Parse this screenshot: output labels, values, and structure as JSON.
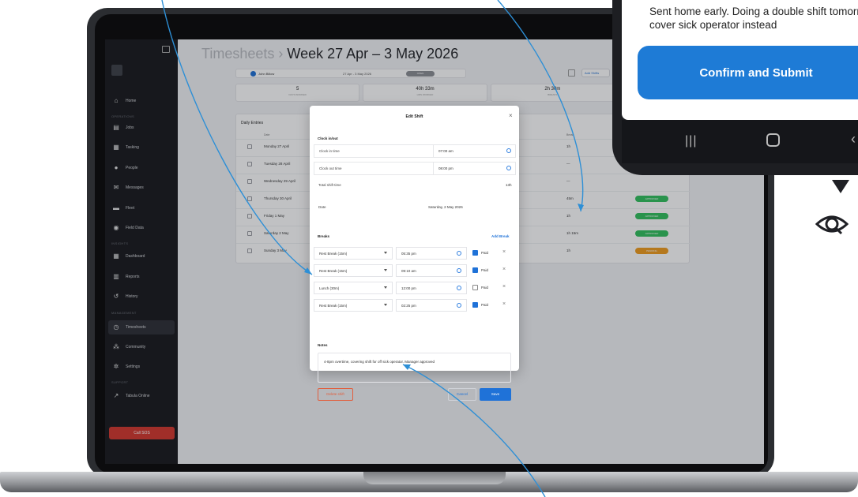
{
  "sidebar": {
    "sections": [
      "OPERATIONS",
      "INSIGHTS",
      "MANAGEMENT",
      "SUPPORT"
    ],
    "items": [
      {
        "label": "Home",
        "icon": "home-icon"
      },
      {
        "label": "Jobs",
        "icon": "jobs-icon"
      },
      {
        "label": "Tasking",
        "icon": "tasking-icon"
      },
      {
        "label": "People",
        "icon": "people-icon"
      },
      {
        "label": "Messages",
        "icon": "messages-icon"
      },
      {
        "label": "Fleet",
        "icon": "fleet-icon"
      },
      {
        "label": "Field Data",
        "icon": "field-data-icon"
      },
      {
        "label": "Dashboard",
        "icon": "dashboard-icon"
      },
      {
        "label": "Reports",
        "icon": "reports-icon"
      },
      {
        "label": "History",
        "icon": "history-icon"
      },
      {
        "label": "Timesheets",
        "icon": "clock-icon"
      },
      {
        "label": "Community",
        "icon": "community-icon"
      },
      {
        "label": "Settings",
        "icon": "gear-icon"
      },
      {
        "label": "Tabula Online",
        "icon": "external-link-icon"
      }
    ],
    "sos_label": "Call SOS"
  },
  "header": {
    "crumb": "Timesheets",
    "separator": "›",
    "title": "Week 27 Apr – 3 May 2026"
  },
  "toolbar": {
    "employee": "John Billow",
    "week_range": "27 Apr - 3 May 2026",
    "status": "OPEN",
    "add_label": "Add Shifts"
  },
  "stats": [
    {
      "value": "5",
      "label": "DAYS WORKED"
    },
    {
      "value": "40h 33m",
      "label": "HRS WORKED"
    },
    {
      "value": "2h 30m",
      "label": "BREAKS"
    }
  ],
  "entries": {
    "title": "Daily Entries",
    "col_date": "Date",
    "col_break": "Break",
    "rows": [
      {
        "date": "Monday 27 April",
        "break": "1h",
        "status": ""
      },
      {
        "date": "Tuesday 28 April",
        "break": "—",
        "status": ""
      },
      {
        "date": "Wednesday 29 April",
        "break": "—",
        "status": ""
      },
      {
        "date": "Thursday 30 April",
        "break": "45m",
        "status": "APPROVED"
      },
      {
        "date": "Friday 1 May",
        "break": "1h",
        "status": "APPROVED"
      },
      {
        "date": "Saturday 2 May",
        "break": "1h 15m",
        "status": "APPROVED"
      },
      {
        "date": "Sunday 3 May",
        "break": "1h",
        "status": "PENDING"
      }
    ]
  },
  "modal": {
    "title": "Edit Shift",
    "clock_section": "Clock in/out",
    "clock_in_label": "Clock in time",
    "clock_in_value": "07:00 am",
    "clock_out_label": "Clock out time",
    "clock_out_value": "08:00 pm",
    "total_label": "Total shift time",
    "total_value": "13h",
    "date_label": "Date",
    "date_value": "Saturday, 2 May 2026",
    "breaks_section": "Breaks",
    "add_break": "Add Break",
    "paid_label": "Paid",
    "breaks": [
      {
        "type": "Rest Break (15m)",
        "time": "05:35 pm",
        "paid": true
      },
      {
        "type": "Rest Break (15m)",
        "time": "09:10 am",
        "paid": true
      },
      {
        "type": "Lunch (30m)",
        "time": "12:00 pm",
        "paid": false
      },
      {
        "type": "Rest Break (15m)",
        "time": "02:25 pm",
        "paid": true
      }
    ],
    "notes_label": "Notes",
    "notes_value": "4-8pm overtime, covering shift for off sick operator. Manager approved",
    "delete_label": "Delete shift",
    "cancel_label": "Cancel",
    "save_label": "Save"
  },
  "phone": {
    "note_text": "Sent home early. Doing a double shift tomorrow to cover sick operator instead",
    "confirm_label": "Confirm and Submit"
  },
  "colors": {
    "accent": "#1f72d8",
    "approved": "#2fbf5b",
    "pending": "#f09a1a",
    "danger": "#e25e3d",
    "sos": "#d3342a",
    "annotation_line": "#2d8fd6"
  }
}
